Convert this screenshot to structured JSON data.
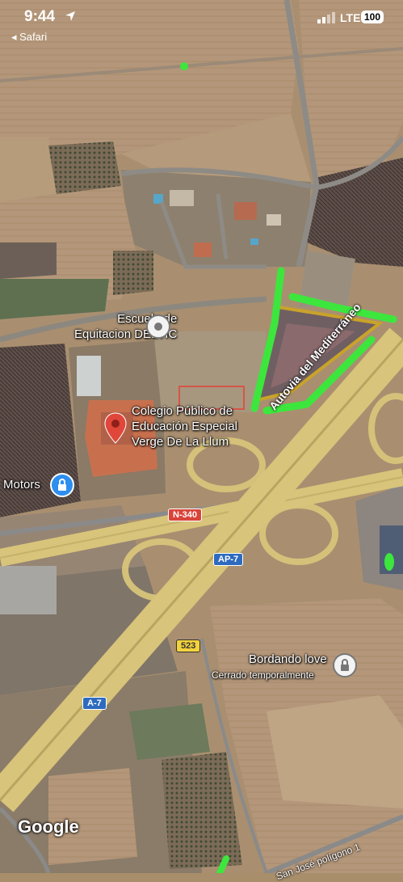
{
  "status_bar": {
    "time": "9:44",
    "back_app": "◂ Safari",
    "network": "LTE",
    "battery": "100"
  },
  "places": {
    "equitacion": [
      "Escuela de",
      "Equitacion DELVIC"
    ],
    "colegio": [
      "Colegio Público de",
      "Educación Especial",
      "Verge De La Llum"
    ],
    "motors": "Motors",
    "bordando": "Bordando love",
    "bordando_status": "Cerrado temporalmente"
  },
  "roads": {
    "autovia": "Autovia del Mediterráneo",
    "n340": "N-340",
    "ap7": "AP-7",
    "r523": "523",
    "a7": "A-7",
    "san_jose": "San José polígono 1"
  },
  "attribution": "Google",
  "colors": {
    "highway": "#d8c47a",
    "highlight_green": "#3de63d",
    "school_pin": "#e0463a",
    "parcel_outline": "#c9a32a"
  },
  "icons": [
    "location-arrow-icon",
    "signal-icon",
    "battery-icon",
    "map-pin-icon",
    "school-pin-icon",
    "lock-icon"
  ]
}
